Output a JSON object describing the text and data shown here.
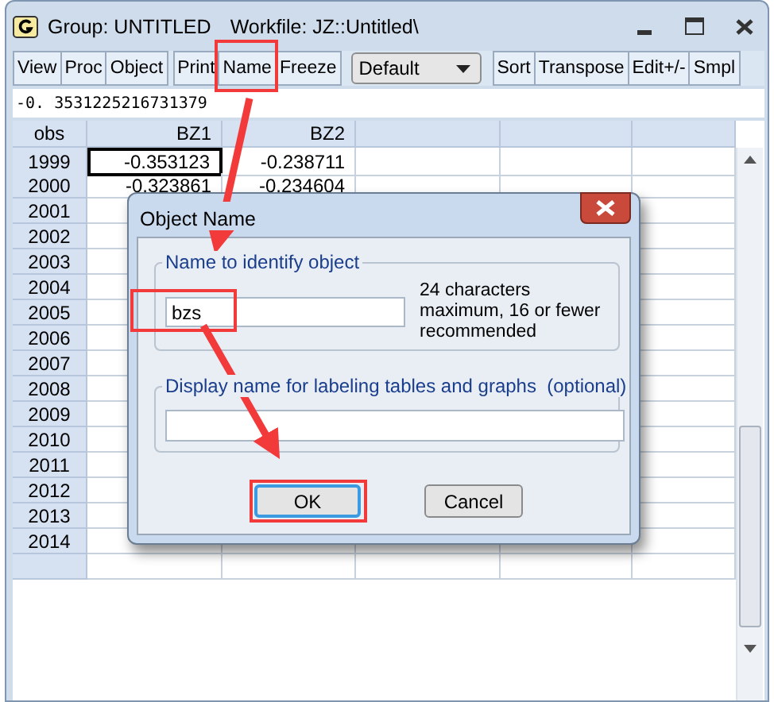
{
  "window": {
    "title": "Group: UNTITLED",
    "workfile": "Workfile: JZ::Untitled\\"
  },
  "toolbar": [
    {
      "items": [
        {
          "label": "View",
          "kind": "button",
          "highlighted": false
        },
        {
          "label": "Proc",
          "kind": "button",
          "highlighted": false
        },
        {
          "label": "Object",
          "kind": "button",
          "highlighted": false
        }
      ]
    },
    {
      "items": [
        {
          "label": "Print",
          "kind": "button",
          "highlighted": false
        },
        {
          "label": "Name",
          "kind": "button",
          "highlighted": true
        },
        {
          "label": "Freeze",
          "kind": "button",
          "highlighted": false
        }
      ]
    },
    {
      "items": [
        {
          "label": "Default",
          "kind": "dropdown",
          "highlighted": false
        }
      ]
    },
    {
      "items": [
        {
          "label": "Sort",
          "kind": "button",
          "highlighted": false
        },
        {
          "label": "Transpose",
          "kind": "button",
          "highlighted": false
        },
        {
          "label": "Edit+/-",
          "kind": "button",
          "highlighted": false
        },
        {
          "label": "Smpl",
          "kind": "button",
          "highlighted": false
        }
      ]
    }
  ],
  "formula_bar": {
    "value": "-0. 3531225216731379"
  },
  "table": {
    "columns": [
      "obs",
      "BZ1",
      "BZ2"
    ],
    "rows": [
      {
        "obs": "1999",
        "cells": [
          {
            "text": "-0.353123",
            "selected": true
          },
          {
            "text": "-0.238711",
            "selected": false
          }
        ]
      },
      {
        "obs": "2000",
        "cells": [
          {
            "text": "-0.323861",
            "selected": false
          },
          {
            "text": "-0.234604",
            "selected": false
          }
        ]
      },
      {
        "obs": "2001"
      },
      {
        "obs": "2002"
      },
      {
        "obs": "2003"
      },
      {
        "obs": "2004"
      },
      {
        "obs": "2005"
      },
      {
        "obs": "2006"
      },
      {
        "obs": "2007"
      },
      {
        "obs": "2008"
      },
      {
        "obs": "2009"
      },
      {
        "obs": "2010"
      },
      {
        "obs": "2011"
      },
      {
        "obs": "2012"
      },
      {
        "obs": "2013"
      },
      {
        "obs": "2014"
      }
    ]
  },
  "dialog": {
    "title": "Object Name",
    "name_group": {
      "legend": "Name to identify object",
      "value": "bzs",
      "highlighted": true,
      "hint": "24 characters maximum, 16 or fewer recommended"
    },
    "display_group": {
      "legend": "Display name for labeling tables and graphs  (optional)"
    },
    "buttons": [
      {
        "label": "OK",
        "default": true,
        "highlighted": true
      },
      {
        "label": "Cancel",
        "default": false,
        "highlighted": false
      }
    ]
  }
}
